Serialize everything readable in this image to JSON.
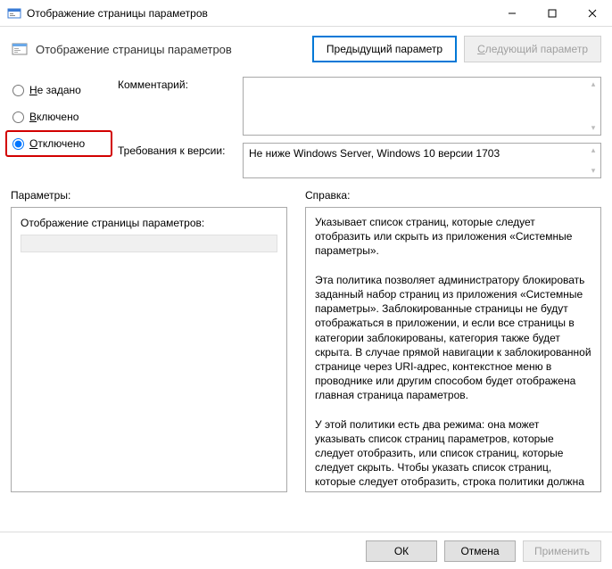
{
  "window": {
    "title": "Отображение страницы параметров"
  },
  "subheader": {
    "title": "Отображение страницы параметров",
    "prev": "Предыдущий параметр",
    "next_prefix": "С",
    "next_rest": "ледующий параметр"
  },
  "radios": {
    "not_configured_prefix": "Н",
    "not_configured_rest": "е задано",
    "enabled_prefix": "В",
    "enabled_rest": "ключено",
    "disabled_prefix": "О",
    "disabled_rest": "тключено"
  },
  "fields": {
    "comment_label": "Комментарий:",
    "requirements_label": "Требования к версии:",
    "requirements_value": "Не ниже Windows Server, Windows 10 версии 1703"
  },
  "sections": {
    "parameters": "Параметры:",
    "help": "Справка:"
  },
  "parameters_panel": {
    "label": "Отображение страницы параметров:"
  },
  "help_text": "Указывает список страниц, которые следует отобразить или скрыть из приложения «Системные параметры».\n\nЭта политика позволяет администратору блокировать заданный набор страниц из приложения «Системные параметры». Заблокированные страницы не будут отображаться в приложении, и если все страницы в категории заблокированы, категория также будет скрыта. В случае прямой навигации к заблокированной странице через URI-адрес, контекстное меню в проводнике или другим способом будет отображена главная страница параметров.\n\nУ этой политики есть два режима: она может указывать список страниц параметров, которые следует отобразить, или список страниц, которые следует скрыть. Чтобы указать список страниц, которые следует отобразить, строка политики должна начинаться с «showonly:» (без кавычек), а чтобы указать список страниц, которые следует скрыть, она должна начинаться с «hide:». Если страница из списка showonly обычно была бы скрыта по другим причинам",
  "footer": {
    "ok": "ОК",
    "cancel": "Отмена",
    "apply_prefix": "П",
    "apply_rest": "рименить"
  }
}
